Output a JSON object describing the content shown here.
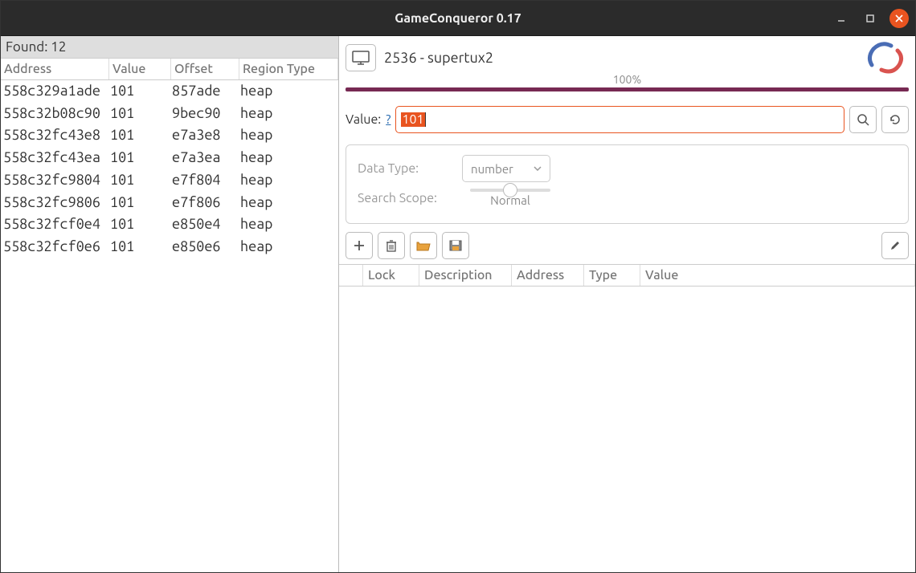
{
  "window": {
    "title": "GameConqueror 0.17"
  },
  "found": {
    "label": "Found: 12"
  },
  "results": {
    "headers": {
      "address": "Address",
      "value": "Value",
      "offset": "Offset",
      "region": "Region Type"
    },
    "rows": [
      {
        "address": "558c329a1ade",
        "value": "101",
        "offset": "857ade",
        "region": "heap"
      },
      {
        "address": "558c32b08c90",
        "value": "101",
        "offset": "9bec90",
        "region": "heap"
      },
      {
        "address": "558c32fc43e8",
        "value": "101",
        "offset": "e7a3e8",
        "region": "heap"
      },
      {
        "address": "558c32fc43ea",
        "value": "101",
        "offset": "e7a3ea",
        "region": "heap"
      },
      {
        "address": "558c32fc9804",
        "value": "101",
        "offset": "e7f804",
        "region": "heap"
      },
      {
        "address": "558c32fc9806",
        "value": "101",
        "offset": "e7f806",
        "region": "heap"
      },
      {
        "address": "558c32fcf0e4",
        "value": "101",
        "offset": "e850e4",
        "region": "heap"
      },
      {
        "address": "558c32fcf0e6",
        "value": "101",
        "offset": "e850e6",
        "region": "heap"
      }
    ]
  },
  "process": {
    "label": "2536 - supertux2"
  },
  "progress": {
    "text": "100%"
  },
  "search": {
    "label": "Value:",
    "help": "?",
    "input": "101"
  },
  "options": {
    "datatype_label": "Data Type:",
    "datatype_value": "number",
    "scope_label": "Search Scope:",
    "scope_value": "Normal"
  },
  "cheat_headers": {
    "lock": "Lock",
    "description": "Description",
    "address": "Address",
    "type": "Type",
    "value": "Value"
  }
}
